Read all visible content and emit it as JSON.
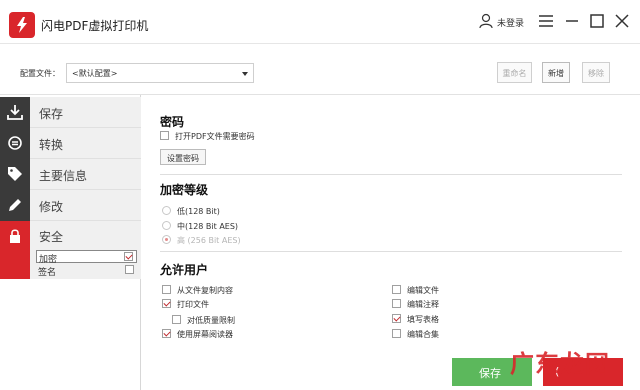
{
  "app": {
    "title": "闪电PDF虚拟打印机",
    "login": "未登录"
  },
  "config": {
    "label": "配置文件：",
    "selected": "<默认配置>",
    "rename": "重命名",
    "new": "新增",
    "remove": "移除"
  },
  "sidebar": {
    "items": [
      {
        "label": "保存",
        "icon": "download-icon"
      },
      {
        "label": "转换",
        "icon": "convert-icon"
      },
      {
        "label": "主要信息",
        "icon": "tag-icon"
      },
      {
        "label": "修改",
        "icon": "pencil-icon"
      }
    ],
    "active": {
      "label": "安全",
      "icon": "lock-icon",
      "subs": [
        {
          "label": "加密",
          "checked": true
        },
        {
          "label": "签名",
          "checked": false
        }
      ]
    }
  },
  "password": {
    "title": "密码",
    "require_open": "打开PDF文件需要密码",
    "set_button": "设置密码"
  },
  "encryption": {
    "title": "加密等级",
    "options": [
      {
        "label": "低(128 Bit)",
        "selected": false,
        "disabled": false
      },
      {
        "label": "中(128 Bit AES)",
        "selected": false,
        "disabled": false
      },
      {
        "label": "高 (256 Bit AES)",
        "selected": true,
        "disabled": true
      }
    ]
  },
  "permissions": {
    "title": "允许用户",
    "left": [
      {
        "label": "从文件复制内容",
        "checked": false
      },
      {
        "label": "打印文件",
        "checked": true
      },
      {
        "label": "对低质量限制",
        "checked": false
      },
      {
        "label": "使用屏幕阅读器",
        "checked": true
      }
    ],
    "right": [
      {
        "label": "编辑文件",
        "checked": false
      },
      {
        "label": "编辑注释",
        "checked": false
      },
      {
        "label": "填写表格",
        "checked": true
      },
      {
        "label": "编辑合集",
        "checked": false
      }
    ]
  },
  "footer": {
    "save": "保存",
    "second": "(",
    "watermark": "广东龙网"
  },
  "colors": {
    "accent": "#d9262b",
    "nav_dark": "#3a3a3a",
    "save_green": "#5cb85c"
  }
}
